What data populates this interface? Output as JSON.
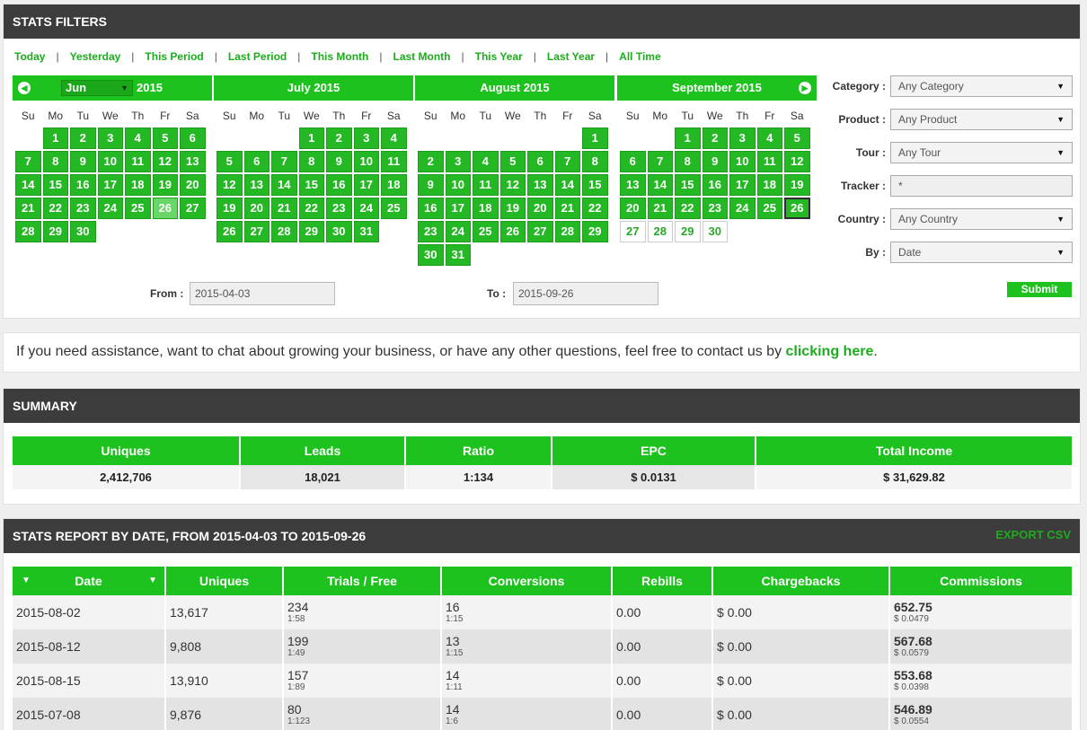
{
  "filters": {
    "title": "STATS FILTERS",
    "quick_links": [
      "Today",
      "Yesterday",
      "This Period",
      "Last Period",
      "This Month",
      "Last Month",
      "This Year",
      "Last Year",
      "All Time"
    ],
    "separator": "|",
    "month_select": "Jun",
    "year": "2015",
    "prev_icon": "prev-month-icon",
    "next_icon": "next-month-icon",
    "weekdays": [
      "Su",
      "Mo",
      "Tu",
      "We",
      "Th",
      "Fr",
      "Sa"
    ],
    "calendars": [
      {
        "title": "",
        "offset": 1,
        "days": 30,
        "highlight": 26,
        "selected": null,
        "last_enabled": 30
      },
      {
        "title": "July 2015",
        "offset": 3,
        "days": 31,
        "highlight": null,
        "selected": null,
        "last_enabled": 31
      },
      {
        "title": "August 2015",
        "offset": 6,
        "days": 31,
        "highlight": null,
        "selected": null,
        "last_enabled": 31
      },
      {
        "title": "September 2015",
        "offset": 2,
        "days": 30,
        "highlight": null,
        "selected": 26,
        "last_enabled": 26
      }
    ],
    "from_label": "From :",
    "from_value": "2015-04-03",
    "to_label": "To :",
    "to_value": "2015-09-26",
    "fields": [
      {
        "label": "Category :",
        "value": "Any Category",
        "type": "select"
      },
      {
        "label": "Product :",
        "value": "Any Product",
        "type": "select"
      },
      {
        "label": "Tour :",
        "value": "Any Tour",
        "type": "select"
      },
      {
        "label": "Tracker :",
        "value": "*",
        "type": "text"
      },
      {
        "label": "Country :",
        "value": "Any Country",
        "type": "select"
      },
      {
        "label": "By :",
        "value": "Date",
        "type": "select"
      }
    ],
    "submit_label": "Submit"
  },
  "contact": {
    "text": "If you need assistance, want to chat about growing your business, or have any other questions, feel free to contact us by ",
    "link": "clicking here",
    "end": "."
  },
  "summary": {
    "title": "SUMMARY",
    "headers": [
      "Uniques",
      "Leads",
      "Ratio",
      "EPC",
      "Total Income"
    ],
    "values": [
      "2,412,706",
      "18,021",
      "1:134",
      "$ 0.0131",
      "$ 31,629.82"
    ]
  },
  "report": {
    "title": "STATS REPORT BY DATE, FROM 2015-04-03 TO 2015-09-26",
    "export_label": "EXPORT CSV",
    "headers": [
      "Date",
      "Uniques",
      "Trials / Free",
      "Conversions",
      "Rebills",
      "Chargebacks",
      "Commissions"
    ],
    "rows": [
      {
        "date": "2015-08-02",
        "uniques": "13,617",
        "trials": "234",
        "trials_ratio": "1:58",
        "conv": "16",
        "conv_ratio": "1:15",
        "rebills": "0.00",
        "chargebacks": "$ 0.00",
        "comm": "652.75",
        "comm_epc": "$ 0.0479"
      },
      {
        "date": "2015-08-12",
        "uniques": "9,808",
        "trials": "199",
        "trials_ratio": "1:49",
        "conv": "13",
        "conv_ratio": "1:15",
        "rebills": "0.00",
        "chargebacks": "$ 0.00",
        "comm": "567.68",
        "comm_epc": "$ 0.0579"
      },
      {
        "date": "2015-08-15",
        "uniques": "13,910",
        "trials": "157",
        "trials_ratio": "1:89",
        "conv": "14",
        "conv_ratio": "1:11",
        "rebills": "0.00",
        "chargebacks": "$ 0.00",
        "comm": "553.68",
        "comm_epc": "$ 0.0398"
      },
      {
        "date": "2015-07-08",
        "uniques": "9,876",
        "trials": "80",
        "trials_ratio": "1:123",
        "conv": "14",
        "conv_ratio": "1:6",
        "rebills": "0.00",
        "chargebacks": "$ 0.00",
        "comm": "546.89",
        "comm_epc": "$ 0.0554"
      }
    ]
  },
  "colors": {
    "accent": "#1ec21e",
    "header": "#3c3c3c",
    "link": "#1bad1b"
  }
}
